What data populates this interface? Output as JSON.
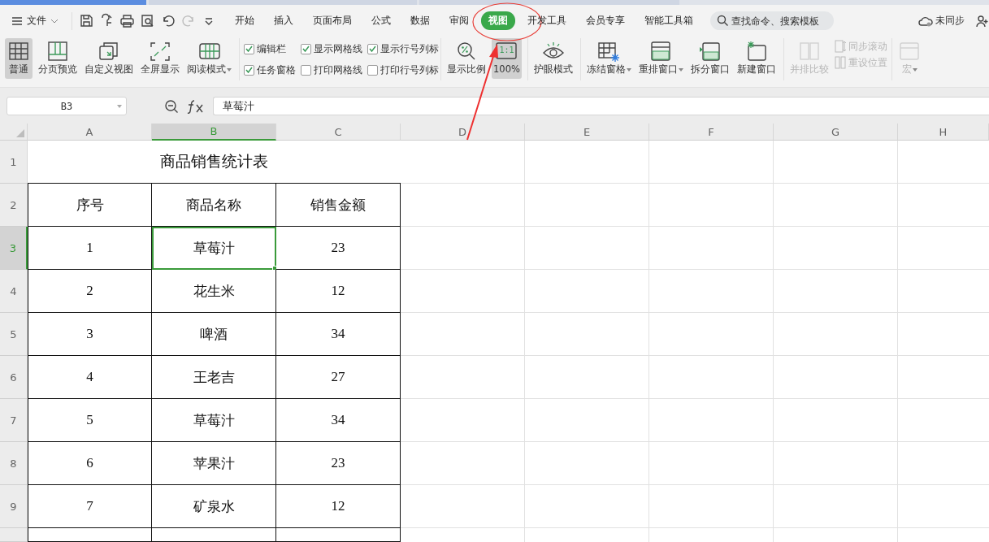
{
  "menubar": {
    "file_menu": {
      "label": "文件"
    },
    "quick_access": [
      {
        "disabled": false
      },
      {
        "disabled": false
      },
      {
        "disabled": false
      },
      {
        "disabled": false
      },
      {
        "disabled": false
      },
      {
        "disabled": true
      },
      {
        "disabled": false
      }
    ],
    "tabs": [
      {
        "label": "开始",
        "selected": false
      },
      {
        "label": "插入",
        "selected": false
      },
      {
        "label": "页面布局",
        "selected": false
      },
      {
        "label": "公式",
        "selected": false
      },
      {
        "label": "数据",
        "selected": false
      },
      {
        "label": "审阅",
        "selected": false
      },
      {
        "label": "视图",
        "selected": true
      },
      {
        "label": "开发工具",
        "selected": false
      },
      {
        "label": "会员专享",
        "selected": false
      },
      {
        "label": "智能工具箱",
        "selected": false
      }
    ],
    "search": {
      "placeholder": "查找命令、搜索模板"
    },
    "sync": {
      "label": "未同步"
    }
  },
  "ribbon": {
    "items": [
      {
        "kind": "large",
        "label": "普通",
        "selected": true,
        "disabled": false,
        "dropdown": false
      },
      {
        "kind": "large",
        "label": "分页预览",
        "selected": false,
        "disabled": false,
        "dropdown": false
      },
      {
        "kind": "large",
        "label": "自定义视图",
        "selected": false,
        "disabled": false,
        "dropdown": false
      },
      {
        "kind": "large",
        "label": "全屏显示",
        "selected": false,
        "disabled": false,
        "dropdown": false
      },
      {
        "kind": "large",
        "label": "阅读模式",
        "selected": false,
        "disabled": false,
        "dropdown": true
      },
      {
        "kind": "separator"
      },
      {
        "kind": "checks",
        "checks": [
          {
            "label": "编辑栏",
            "checked": true
          },
          {
            "label": "任务窗格",
            "checked": true
          },
          {
            "label": "显示网格线",
            "checked": true
          },
          {
            "label": "打印网格线",
            "checked": false
          },
          {
            "label": "显示行号列标",
            "checked": true
          },
          {
            "label": "打印行号列标",
            "checked": false
          }
        ]
      },
      {
        "kind": "separator"
      },
      {
        "kind": "large",
        "label": "显示比例",
        "selected": false,
        "disabled": false,
        "dropdown": false
      },
      {
        "kind": "large",
        "label": "100%",
        "icon_text": "1:1",
        "selected": true,
        "disabled": false,
        "dropdown": false
      },
      {
        "kind": "separator"
      },
      {
        "kind": "large",
        "label": "护眼模式",
        "selected": false,
        "disabled": false,
        "dropdown": false
      },
      {
        "kind": "separator"
      },
      {
        "kind": "large",
        "label": "冻结窗格",
        "selected": false,
        "disabled": false,
        "dropdown": true
      },
      {
        "kind": "large",
        "label": "重排窗口",
        "selected": false,
        "disabled": false,
        "dropdown": true
      },
      {
        "kind": "large",
        "label": "拆分窗口",
        "selected": false,
        "disabled": false,
        "dropdown": false
      },
      {
        "kind": "large",
        "label": "新建窗口",
        "selected": false,
        "disabled": false,
        "dropdown": false
      },
      {
        "kind": "separator"
      },
      {
        "kind": "large",
        "label": "并排比较",
        "selected": false,
        "disabled": true,
        "dropdown": false
      },
      {
        "kind": "small",
        "buttons": [
          {
            "label": "同步滚动",
            "disabled": true
          },
          {
            "label": "重设位置",
            "disabled": true
          }
        ]
      },
      {
        "kind": "separator"
      },
      {
        "kind": "large",
        "label": "宏",
        "selected": false,
        "disabled": true,
        "dropdown": true
      }
    ]
  },
  "formula_bar": {
    "name_box": {
      "value": "B3"
    },
    "formula": {
      "value": "草莓汁"
    }
  },
  "sheet": {
    "columns": [
      {
        "label": "A",
        "selected": false
      },
      {
        "label": "B",
        "selected": true
      },
      {
        "label": "C",
        "selected": false
      },
      {
        "label": "D",
        "selected": false
      },
      {
        "label": "E",
        "selected": false
      },
      {
        "label": "F",
        "selected": false
      },
      {
        "label": "G",
        "selected": false
      },
      {
        "label": "H",
        "selected": false
      }
    ],
    "rows": [
      {
        "label": "1",
        "selected": false,
        "kind": "title",
        "bordered": false,
        "cells": [
          {
            "text": "商品销售统计表",
            "active": false,
            "colspan": 3
          }
        ]
      },
      {
        "label": "2",
        "selected": false,
        "kind": "data",
        "bordered": true,
        "cells": [
          {
            "text": "序号",
            "active": false
          },
          {
            "text": "商品名称",
            "active": false
          },
          {
            "text": "销售金额",
            "active": false
          }
        ]
      },
      {
        "label": "3",
        "selected": true,
        "kind": "data",
        "bordered": true,
        "cells": [
          {
            "text": "1",
            "active": false
          },
          {
            "text": "草莓汁",
            "active": true
          },
          {
            "text": "23",
            "active": false
          }
        ]
      },
      {
        "label": "4",
        "selected": false,
        "kind": "data",
        "bordered": true,
        "cells": [
          {
            "text": "2",
            "active": false
          },
          {
            "text": "花生米",
            "active": false
          },
          {
            "text": "12",
            "active": false
          }
        ]
      },
      {
        "label": "5",
        "selected": false,
        "kind": "data",
        "bordered": true,
        "cells": [
          {
            "text": "3",
            "active": false
          },
          {
            "text": "啤酒",
            "active": false
          },
          {
            "text": "34",
            "active": false
          }
        ]
      },
      {
        "label": "6",
        "selected": false,
        "kind": "data",
        "bordered": true,
        "cells": [
          {
            "text": "4",
            "active": false
          },
          {
            "text": "王老吉",
            "active": false
          },
          {
            "text": "27",
            "active": false
          }
        ]
      },
      {
        "label": "7",
        "selected": false,
        "kind": "data",
        "bordered": true,
        "cells": [
          {
            "text": "5",
            "active": false
          },
          {
            "text": "草莓汁",
            "active": false
          },
          {
            "text": "34",
            "active": false
          }
        ]
      },
      {
        "label": "8",
        "selected": false,
        "kind": "data",
        "bordered": true,
        "cells": [
          {
            "text": "6",
            "active": false
          },
          {
            "text": "苹果汁",
            "active": false
          },
          {
            "text": "23",
            "active": false
          }
        ]
      },
      {
        "label": "9",
        "selected": false,
        "kind": "data",
        "bordered": true,
        "cells": [
          {
            "text": "7",
            "active": false
          },
          {
            "text": "矿泉水",
            "active": false
          },
          {
            "text": "12",
            "active": false
          }
        ]
      }
    ]
  }
}
